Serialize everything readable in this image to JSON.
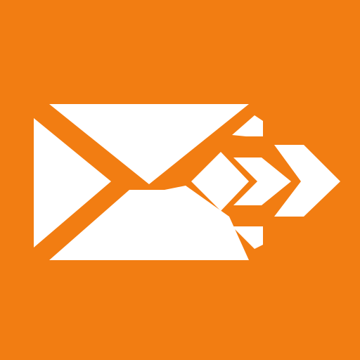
{
  "icon": {
    "name": "send-mail-icon",
    "background_color": "#F27D12",
    "foreground_color": "#FFFFFF"
  }
}
